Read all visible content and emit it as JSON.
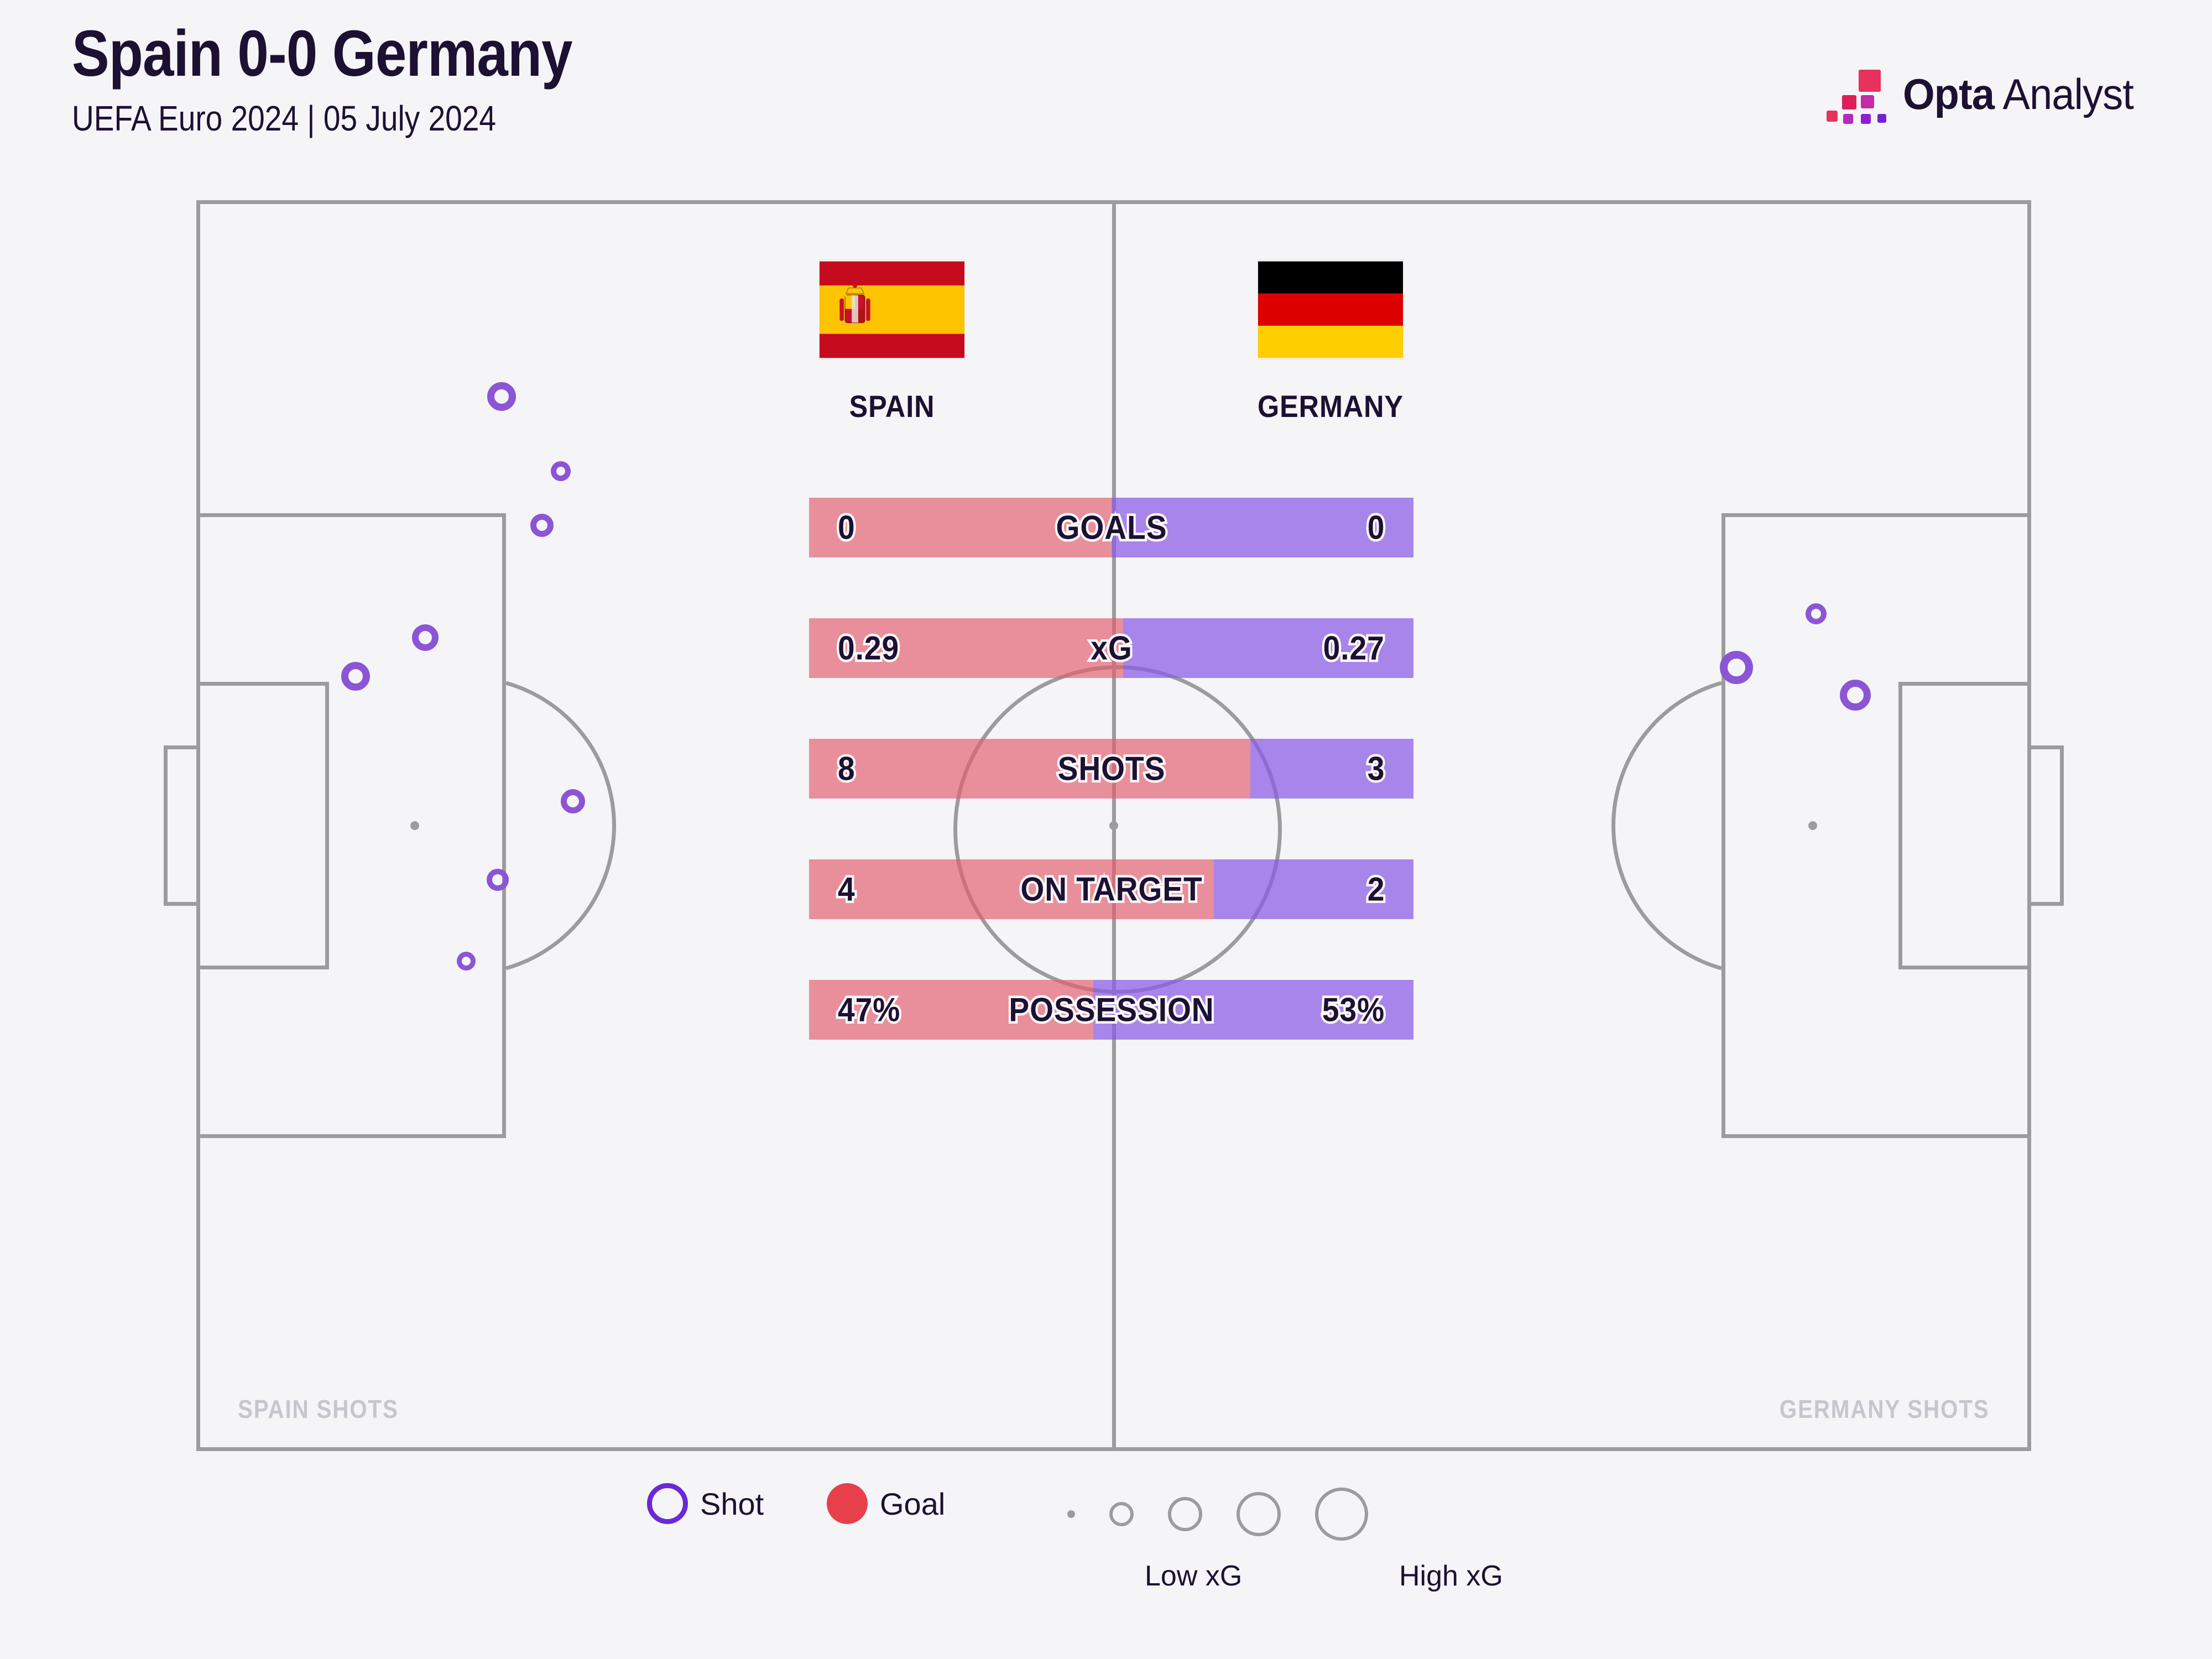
{
  "header": {
    "title": "Spain 0-0 Germany",
    "subtitle": "UEFA Euro 2024 | 05 July 2024"
  },
  "logo": {
    "brand_bold": "Opta",
    "brand_light": " Analyst",
    "colors": [
      "#E8315C",
      "#E01E5A",
      "#D32C8E",
      "#AE2BC8",
      "#8A1FD6"
    ]
  },
  "teams": {
    "home": {
      "name": "SPAIN",
      "flag": "spain-flag",
      "color": "#E15F6E"
    },
    "away": {
      "name": "GERMANY",
      "flag": "germany-flag",
      "color": "#895AE6"
    }
  },
  "stats": [
    {
      "label": "GOALS",
      "home": "0",
      "away": "0",
      "home_pct": 50
    },
    {
      "label": "xG",
      "home": "0.29",
      "away": "0.27",
      "home_pct": 52
    },
    {
      "label": "SHOTS",
      "home": "8",
      "away": "3",
      "home_pct": 73
    },
    {
      "label": "ON TARGET",
      "home": "4",
      "away": "2",
      "home_pct": 67
    },
    {
      "label": "POSSESSION",
      "home": "47%",
      "away": "53%",
      "home_pct": 47
    }
  ],
  "pitch": {
    "home_shots_label": "SPAIN SHOTS",
    "away_shots_label": "GERMANY SHOTS"
  },
  "legend": {
    "shot_label": "Shot",
    "goal_label": "Goal",
    "low_xg_label": "Low xG",
    "high_xg_label": "High xG"
  },
  "chart_data": {
    "type": "scatter",
    "title": "Spain 0-0 Germany",
    "subtitle": "UEFA Euro 2024 | 05 July 2024",
    "description": "Shot map with match statistics comparison bars",
    "marker_encoding": "circle radius proportional to xG value; open purple ring = shot, filled red = goal",
    "stat_categories": [
      "GOALS",
      "xG",
      "SHOTS",
      "ON TARGET",
      "POSSESSION"
    ],
    "series": [
      {
        "name": "SPAIN",
        "values": [
          0,
          0.29,
          8,
          4,
          47
        ]
      },
      {
        "name": "GERMANY",
        "values": [
          0,
          0.27,
          3,
          2,
          53
        ]
      }
    ],
    "home_shots": [
      {
        "x": 16.7,
        "y": 15.2,
        "r": 26,
        "xg": 0.06,
        "goal": false
      },
      {
        "x": 20.1,
        "y": 21.5,
        "r": 18,
        "xg": 0.03,
        "goal": false
      },
      {
        "x": 19.0,
        "y": 25.6,
        "r": 21,
        "xg": 0.04,
        "goal": false
      },
      {
        "x": 12.5,
        "y": 34.2,
        "r": 24,
        "xg": 0.05,
        "goal": false
      },
      {
        "x": 8.4,
        "y": 37.2,
        "r": 26,
        "xg": 0.055,
        "goal": false
      },
      {
        "x": 20.8,
        "y": 47.3,
        "r": 22,
        "xg": 0.04,
        "goal": false
      },
      {
        "x": 16.5,
        "y": 53.5,
        "r": 20,
        "xg": 0.035,
        "goal": false
      },
      {
        "x": 14.9,
        "y": 60.0,
        "r": 17,
        "xg": 0.025,
        "goal": false
      }
    ],
    "away_shots": [
      {
        "x": 83.8,
        "y": 36.7,
        "r": 30,
        "xg": 0.12,
        "goal": false
      },
      {
        "x": 88.2,
        "y": 33.1,
        "r": 19,
        "xg": 0.05,
        "goal": false
      },
      {
        "x": 90.1,
        "y": 39.0,
        "r": 28,
        "xg": 0.1,
        "goal": false
      }
    ]
  }
}
